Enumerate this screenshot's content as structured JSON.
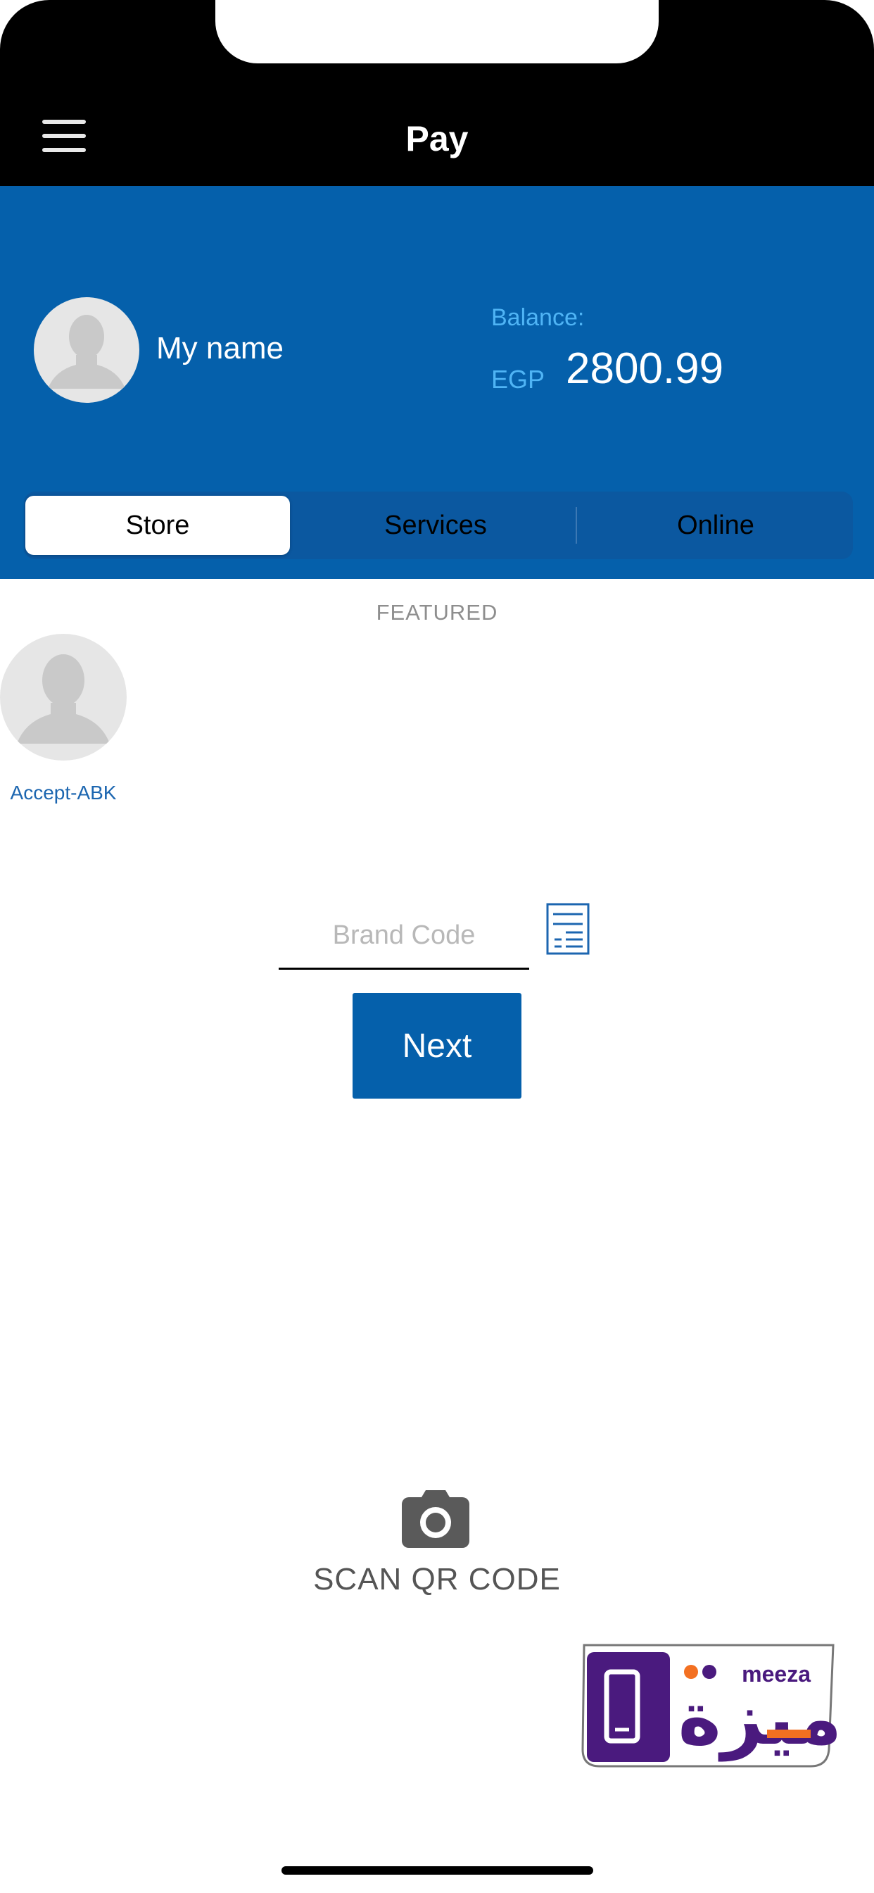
{
  "header": {
    "title": "Pay"
  },
  "profile": {
    "name": "My name",
    "balance_label": "Balance:",
    "currency": "EGP",
    "balance": "2800.99"
  },
  "tabs": [
    {
      "label": "Store",
      "active": true
    },
    {
      "label": "Services",
      "active": false
    },
    {
      "label": "Online",
      "active": false
    }
  ],
  "featured": {
    "heading": "FEATURED",
    "items": [
      {
        "label": "Accept-ABK"
      }
    ]
  },
  "brand_code": {
    "placeholder": "Brand Code",
    "value": ""
  },
  "next_button": {
    "label": "Next"
  },
  "scan": {
    "label": "SCAN QR CODE"
  },
  "logo": {
    "latin": "meeza",
    "arabic": "ميزة"
  },
  "colors": {
    "primary": "#0560ab",
    "balance_accent": "#4fb4f5",
    "link": "#1c66b0",
    "logo_purple": "#4a1a7e",
    "logo_orange": "#f37021"
  },
  "icons": [
    "menu-icon",
    "avatar-icon",
    "document-list-icon",
    "camera-icon",
    "phone-icon"
  ]
}
